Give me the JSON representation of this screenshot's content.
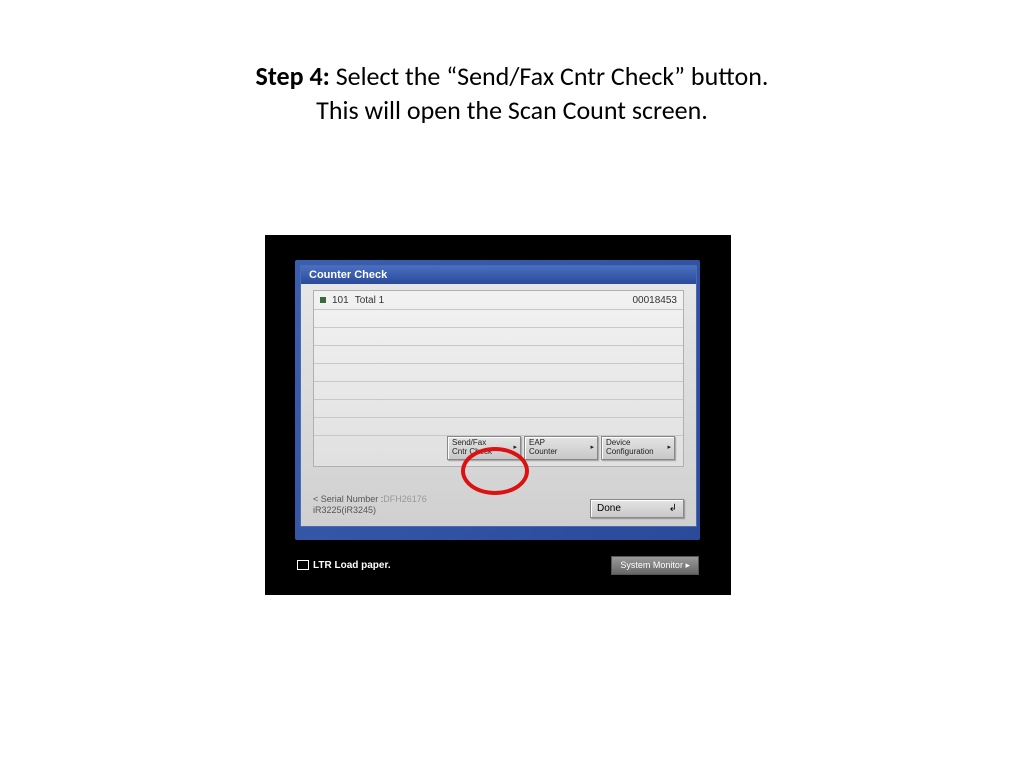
{
  "instruction": {
    "step_label": "Step 4:",
    "line1_rest": " Select the “Send/Fax Cntr Check” button.",
    "line2": "This will open the Scan Count screen."
  },
  "window": {
    "title": "Counter Check",
    "row_id": "101",
    "row_label": "Total 1",
    "row_value": "00018453",
    "serial_label": "< Serial Number :",
    "serial_value": "DFH26176",
    "model": "iR3225(iR3245)"
  },
  "buttons": {
    "sendfax_l1": "Send/Fax",
    "sendfax_l2": "Cntr Check",
    "eap_l1": "EAP",
    "eap_l2": "Counter",
    "device_l1": "Device",
    "device_l2": "Configuration",
    "done": "Done"
  },
  "status": {
    "paper": "LTR Load paper.",
    "sysmon": "System Monitor"
  }
}
